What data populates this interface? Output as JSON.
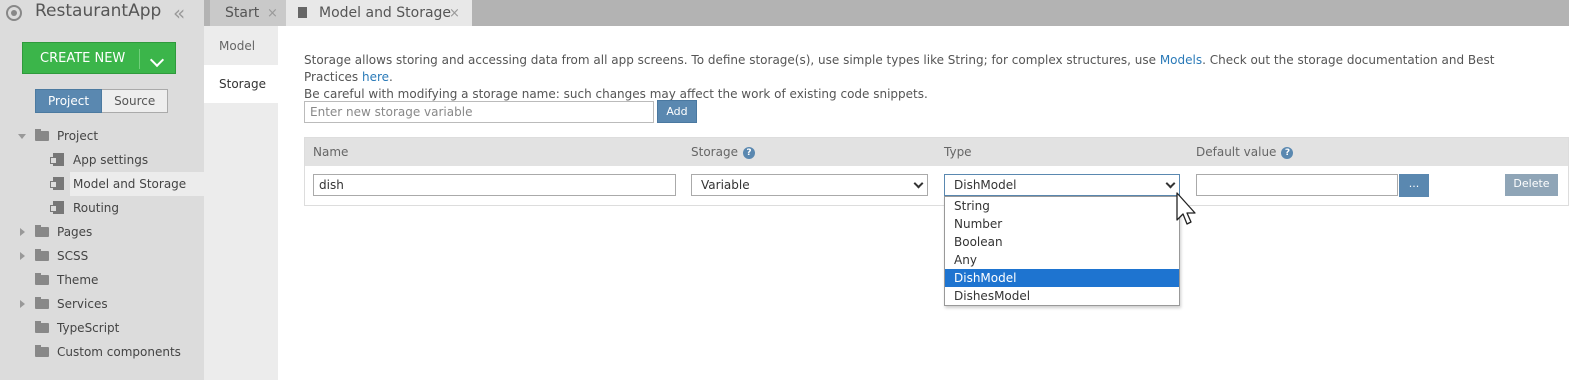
{
  "app": {
    "title": "RestaurantApp",
    "collapse_glyph": "«",
    "logo_icon": "app-logo-icon"
  },
  "sidebar": {
    "create_new_label": "CREATE NEW",
    "segments": {
      "project": "Project",
      "source": "Source",
      "active": "Project"
    },
    "tree": [
      {
        "label": "Project",
        "type": "folder",
        "expanded": true
      },
      {
        "label": "App settings",
        "type": "file"
      },
      {
        "label": "Model and Storage",
        "type": "file",
        "selected": true
      },
      {
        "label": "Routing",
        "type": "file"
      },
      {
        "label": "Pages",
        "type": "folder",
        "expanded": false
      },
      {
        "label": "SCSS",
        "type": "folder",
        "expanded": false
      },
      {
        "label": "Theme",
        "type": "folder"
      },
      {
        "label": "Services",
        "type": "folder",
        "expanded": false
      },
      {
        "label": "TypeScript",
        "type": "folder"
      },
      {
        "label": "Custom components",
        "type": "folder"
      }
    ]
  },
  "tabs": [
    {
      "label": "Start",
      "close": "×",
      "active": false
    },
    {
      "label": "Model and Storage",
      "close": "×",
      "active": true
    }
  ],
  "subnav": {
    "items": [
      {
        "label": "Model",
        "active": false
      },
      {
        "label": "Storage",
        "active": true
      }
    ]
  },
  "storage": {
    "desc_line1_pre": "Storage allows storing and accessing data from all app screens. To define storage(s), use simple types like String; for complex structures, use ",
    "desc_link_models": "Models",
    "desc_line1_mid": ". Check out the storage documentation and Best Practices ",
    "desc_link_here": "here",
    "desc_line1_end": ".",
    "desc_line2": "Be careful with modifying a storage name: such changes may affect the work of existing code snippets.",
    "new_var_placeholder": "Enter new storage variable",
    "add_label": "Add",
    "columns": {
      "name": "Name",
      "storage": "Storage",
      "type": "Type",
      "default_value": "Default value",
      "help_glyph": "?"
    },
    "row": {
      "name": "dish",
      "storage": "Variable",
      "type": "DishModel",
      "default_value": "",
      "dots_label": "...",
      "delete_label": "Delete"
    },
    "type_options": [
      "String",
      "Number",
      "Boolean",
      "Any",
      "DishModel",
      "DishesModel"
    ],
    "type_selected": "DishModel"
  },
  "colors": {
    "accent_blue": "#5a88b0",
    "create_green": "#3bb54a",
    "link_blue": "#2a7ab8",
    "dropdown_highlight": "#1e74d0"
  }
}
